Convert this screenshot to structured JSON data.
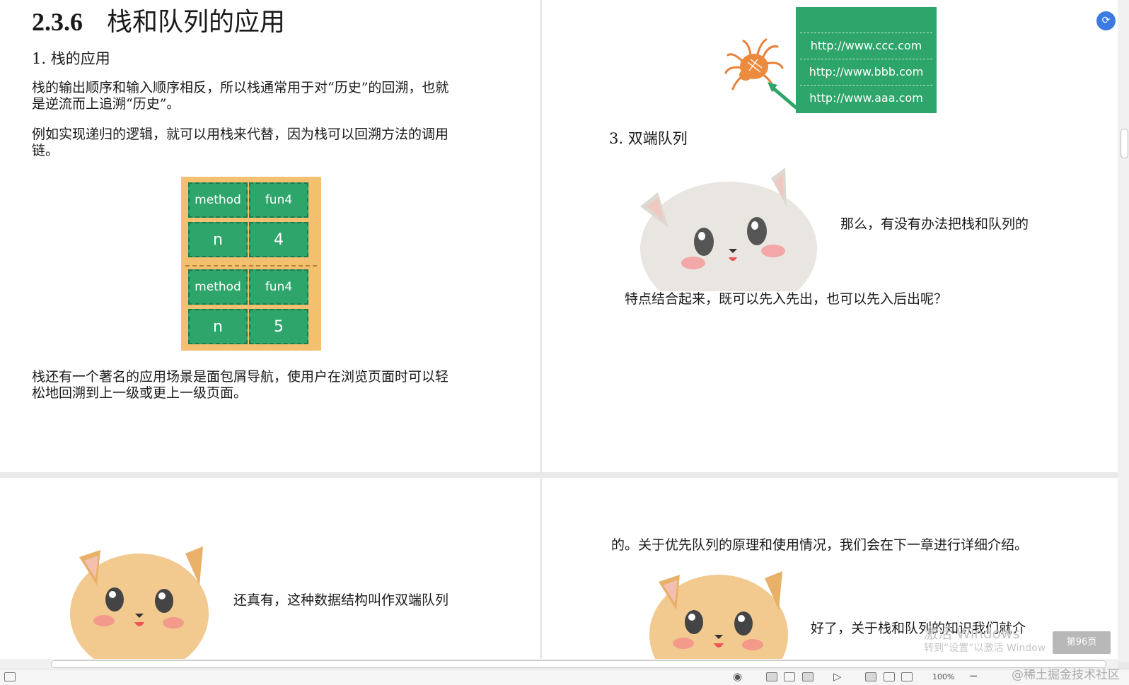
{
  "section": {
    "number": "2.3.6",
    "title": "栈和队列的应用"
  },
  "left_page": {
    "h_stack_use": "1. 栈的应用",
    "p1a": "栈的输出顺序和输入顺序相反，所以栈通常用于对“历史”的回溯，也就",
    "p1b": "是逆流而上追溯“历史”。",
    "p2a": "例如实现递归的逻辑，就可以用栈来代替，因为栈可以回溯方法的调用",
    "p2b": "链。",
    "p3a": "栈还有一个著名的应用场景是面包屑导航，使用户在浏览页面时可以轻",
    "p3b": "松地回溯到上一级或更上一级页面。",
    "stack_frames": [
      {
        "k1": "method",
        "v1": "fun4",
        "k2": "n",
        "v2": "4"
      },
      {
        "k1": "method",
        "v1": "fun4",
        "k2": "n",
        "v2": "5"
      }
    ]
  },
  "right_page": {
    "urls": [
      "http://www.ccc.com",
      "http://www.bbb.com",
      "http://www.aaa.com"
    ],
    "h_deque": "3. 双端队列",
    "q1": "那么，有没有办法把栈和队列的",
    "q2": "特点结合起来，既可以先入先出，也可以先入后出呢？"
  },
  "bottom_left": {
    "text": "还真有，这种数据结构叫作双端队列"
  },
  "bottom_right": {
    "text1": "的。关于优先队列的原理和使用情况，我们会在下一章进行详细介绍。",
    "text2": "好了，关于栈和队列的知识我们就介"
  },
  "overlay": {
    "page_badge": "第96页",
    "watermark1": "激活 Windows",
    "watermark2": "转到“设置”以激活 Window",
    "credit": "@稀土掘金技术社区"
  },
  "statusbar": {
    "zoom": "100%"
  },
  "colors": {
    "card_bg": "#f3c06f",
    "cell_green": "#2ea56a",
    "page_bg": "#ffffff"
  }
}
